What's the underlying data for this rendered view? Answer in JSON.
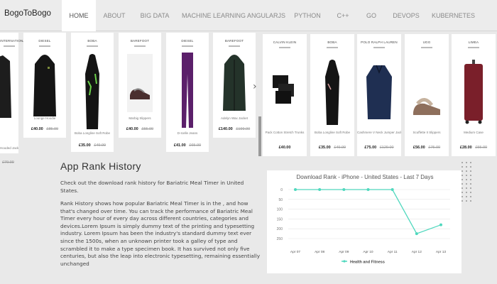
{
  "brand": "BogoToBogo",
  "nav": [
    {
      "label": "HOME",
      "active": true
    },
    {
      "label": "ABOUT"
    },
    {
      "label": "BIG DATA"
    },
    {
      "label": "MACHINE LEARNING"
    },
    {
      "label": "ANGULARJS"
    },
    {
      "label": "PYTHON"
    },
    {
      "label": "C++"
    },
    {
      "label": "GO"
    },
    {
      "label": "DEVOPS"
    },
    {
      "label": "KUBERNETES"
    }
  ],
  "products_left": [
    {
      "brand": "INTERNATIONAL",
      "name": "Hooded Jacket",
      "price_now": "",
      "price_was": "£79.99"
    },
    {
      "brand": "DIESEL",
      "name": "Lounge Hoodie",
      "price_now": "£40.00",
      "price_was": "£85.00"
    },
    {
      "brand": "BOBA",
      "name": "Boba Longline Soft Robe",
      "price_now": "£35.00",
      "price_was": "£49.99"
    },
    {
      "brand": "BAREFOOT",
      "name": "Marbig Slippers",
      "price_now": "£40.00",
      "price_was": "£55.00"
    },
    {
      "brand": "DIESEL",
      "name": "D-Icelle Jeans",
      "price_now": "£41.00",
      "price_was": "£65.00"
    },
    {
      "brand": "BAREFOOT",
      "name": "Adelyn Wax Jacket",
      "price_now": "£140.00",
      "price_was": "£199.00"
    }
  ],
  "products_right": [
    {
      "brand": "CALVIN KLEIN",
      "name": "Pack Cotton Stretch Trunks",
      "price_now": "£40.00",
      "price_was": ""
    },
    {
      "brand": "BOBA",
      "name": "Boba Longline Soft Robe",
      "price_now": "£35.00",
      "price_was": "£49.99"
    },
    {
      "brand": "POLO RALPH LAUREN",
      "name": "Cashmere V Neck Jumper Jacket",
      "price_now": "£75.00",
      "price_was": "£129.00"
    },
    {
      "brand": "UGG",
      "name": "Scuffette II Slippers",
      "price_now": "£56.00",
      "price_was": "£75.00"
    },
    {
      "brand": "LIMEA",
      "name": "Medium Case",
      "price_now": "£28.00",
      "price_was": "£55.00"
    }
  ],
  "rank": {
    "title": "App Rank History",
    "intro": "Check out the download rank history for Bariatric Meal Timer in United States.",
    "body": "Rank History shows how popular Bariatric Meal Timer is in the , and how that's changed over time. You can track the performance of Bariatric Meal Timer every hour of every day across different countries, categories and devices.Lorem Ipsum is simply dummy text of the printing and typesetting industry. Lorem Ipsum has been the industry's standard dummy text ever since the 1500s, when an unknown printer took a galley of type and scrambled it to make a type specimen book. It has survived not only five centuries, but also the leap into electronic typesetting, remaining essentially unchanged"
  },
  "colors": {
    "line": "#50d8be",
    "active_nav_bg": "#ffffff"
  },
  "chart_data": {
    "type": "line",
    "title": "Download Rank - iPhone - United States - Last 7 Days",
    "categories": [
      "Apr 07",
      "Apr 08",
      "Apr 09",
      "Apr 10",
      "Apr 11",
      "Apr 12",
      "Apr 13"
    ],
    "series": [
      {
        "name": "Health and Fitness",
        "values": [
          0,
          0,
          0,
          0,
          0,
          225,
          180
        ]
      }
    ],
    "y_ticks": [
      0,
      50,
      100,
      150,
      200,
      250
    ],
    "ylim": [
      0,
      250
    ],
    "y_inverted": true,
    "grid": true,
    "legend": "bottom"
  }
}
